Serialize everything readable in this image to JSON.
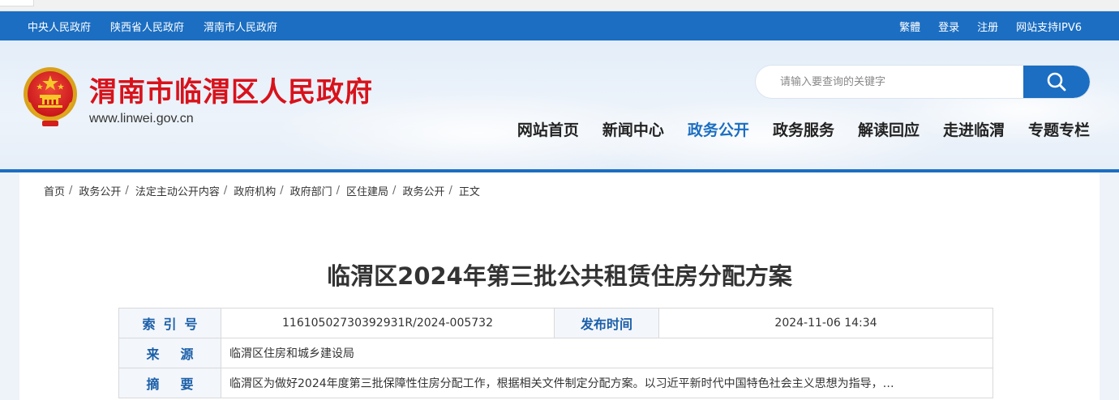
{
  "topbar": {
    "left_links": [
      "中央人民政府",
      "陕西省人民政府",
      "渭南市人民政府"
    ],
    "right_links": [
      "繁體",
      "登录",
      "注册",
      "网站支持IPV6"
    ]
  },
  "header": {
    "site_title": "渭南市临渭区人民政府",
    "site_url": "www.linwei.gov.cn",
    "emblem_icon": "national-emblem-icon"
  },
  "search": {
    "placeholder": "请输入要查询的关键字",
    "button_icon": "search-icon"
  },
  "nav": {
    "items": [
      "网站首页",
      "新闻中心",
      "政务公开",
      "政务服务",
      "解读回应",
      "走进临渭",
      "专题专栏"
    ],
    "active": "政务公开"
  },
  "breadcrumb": [
    "首页",
    "政务公开",
    "法定主动公开内容",
    "政府机构",
    "政府部门",
    "区住建局",
    "政务公开",
    "正文"
  ],
  "article": {
    "title": "临渭区2024年第三批公共租赁住房分配方案"
  },
  "meta": {
    "index_label": "索引号",
    "index_value": "11610502730392931R/2024-005732",
    "publish_label": "发布时间",
    "publish_value": "2024-11-06 14:34",
    "source_label": "来源",
    "source_value": "临渭区住房和城乡建设局",
    "summary_label": "摘要",
    "summary_value": "临渭区为做好2024年度第三批保障性住房分配工作，根据相关文件制定分配方案。以习近平新时代中国特色社会主义思想为指导，…"
  },
  "colors": {
    "brand_blue": "#1b6ec2",
    "title_red": "#d8121b"
  }
}
